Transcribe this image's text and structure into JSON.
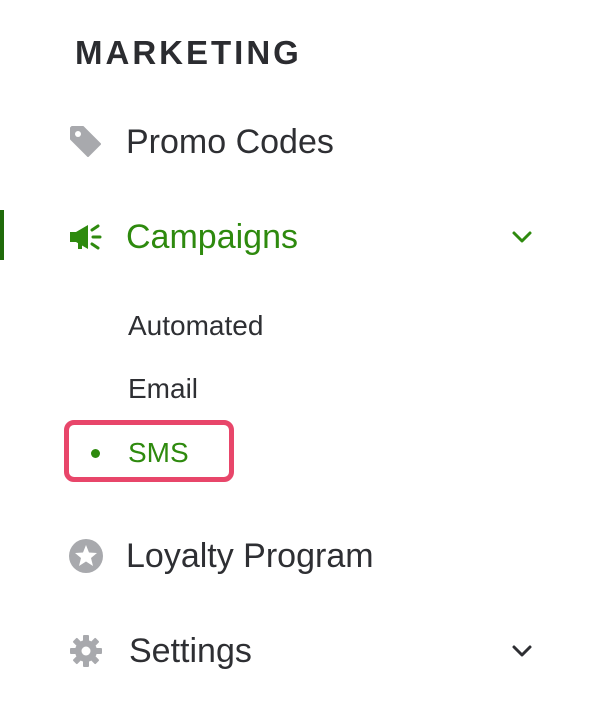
{
  "section": {
    "title": "MARKETING"
  },
  "nav": {
    "promo_codes": {
      "label": "Promo Codes",
      "icon": "tag-icon"
    },
    "campaigns": {
      "label": "Campaigns",
      "icon": "megaphone-icon",
      "expanded": true,
      "active": true,
      "sub_items": [
        {
          "label": "Automated"
        },
        {
          "label": "Email"
        },
        {
          "label": "SMS",
          "active": true
        }
      ]
    },
    "loyalty_program": {
      "label": "Loyalty Program",
      "icon": "star-circle-icon"
    },
    "settings": {
      "label": "Settings",
      "icon": "gear-icon",
      "expanded": false
    }
  },
  "colors": {
    "active_green": "#2e8a0e",
    "active_bar": "#1f6b0a",
    "highlight_box": "#e8466a",
    "icon_gray": "#a8a9ad",
    "text": "#2e2f33"
  }
}
